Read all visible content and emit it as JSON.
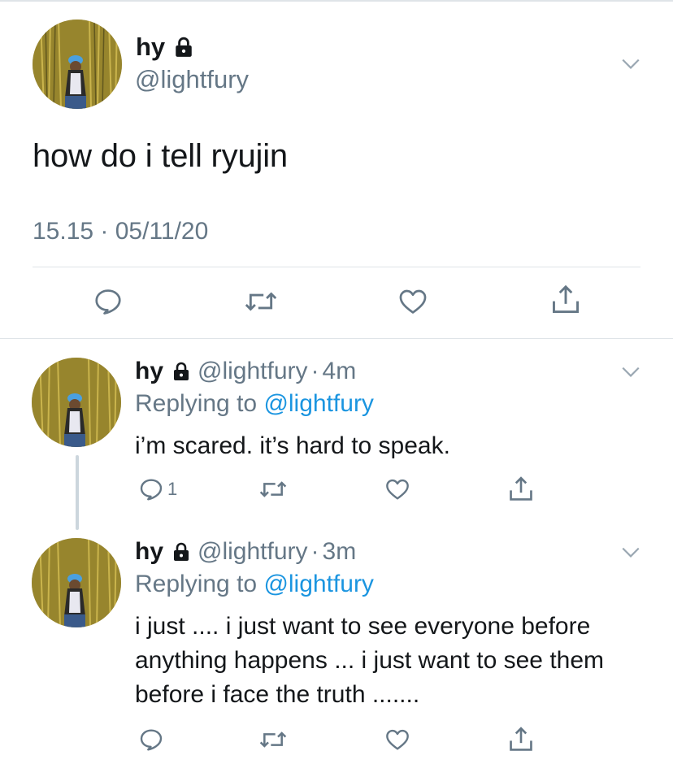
{
  "main_tweet": {
    "name": "hy",
    "handle": "@lightfury",
    "text": "how do i tell ryujin",
    "timestamp": "15.15 · 05/11/20",
    "icons": [
      "lock-icon",
      "chevron-down-icon",
      "reply-icon",
      "retweet-icon",
      "like-icon",
      "share-icon"
    ]
  },
  "replies": [
    {
      "name": "hy",
      "handle": "@lightfury",
      "dot": "·",
      "time": "4m",
      "replying_prefix": "Replying to ",
      "replying_to": "@lightfury",
      "text": "i’m scared. it’s hard to speak.",
      "reply_count": "1"
    },
    {
      "name": "hy",
      "handle": "@lightfury",
      "dot": "·",
      "time": "3m",
      "replying_prefix": "Replying to ",
      "replying_to": "@lightfury",
      "text": "i just .... i just want to see everyone before anything happens ... i just want to see them before i face the truth .......",
      "reply_count": ""
    }
  ],
  "colors": {
    "text": "#14171a",
    "secondary": "#657786",
    "link": "#1b95e0",
    "divider": "#dfe4e8",
    "icon": "#657786"
  }
}
